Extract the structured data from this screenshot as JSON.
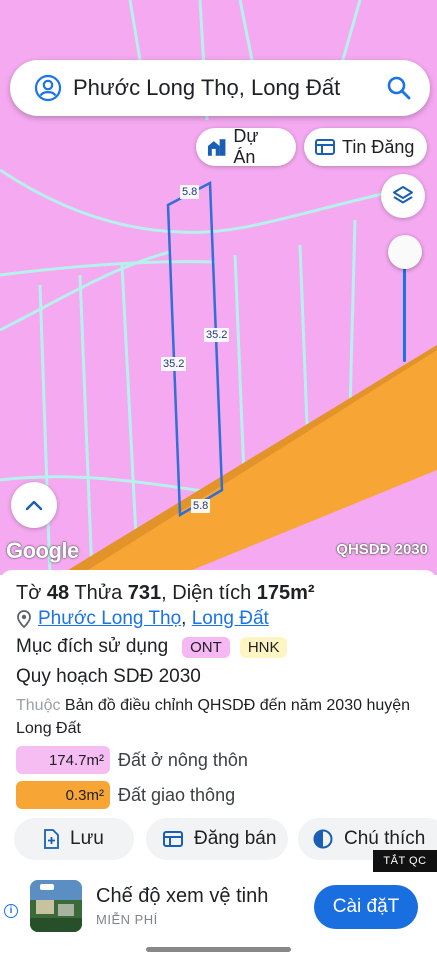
{
  "search": {
    "query": "Phước Long Thọ, Long Đất"
  },
  "map_buttons": {
    "du_an": "Dự Án",
    "tin_dang": "Tin Đăng"
  },
  "map": {
    "watermark": "Google",
    "layer_badge": "QHSDĐ 2030",
    "plot_edges": {
      "top": "5.8",
      "left": "35.2",
      "right": "35.2",
      "bottom": "5.8"
    },
    "colors": {
      "residential": "#f4a9f0",
      "road": "#f7a535",
      "parcel_line": "#b7f1ec",
      "plot_border": "#2f6fd6"
    }
  },
  "parcel": {
    "to_label": "Tờ",
    "to": "48",
    "thua_label": "Thửa",
    "thua": "731",
    "area_label": "Diện tích",
    "area": "175m²",
    "location_1": "Phước Long Thọ",
    "location_sep": ",",
    "location_2": "Long Đất",
    "purpose_label": "Mục đích sử dụng",
    "purpose_tags": [
      "ONT",
      "HNK"
    ],
    "plan_title": "Quy hoạch SDĐ 2030",
    "source_prefix": "Thuộc",
    "source_text": "Bản đồ điều chỉnh QHSDĐ đến năm 2030 huyện Long Đất",
    "legend": [
      {
        "value": "174.7m²",
        "label": "Đất ở nông thôn",
        "color": "#f6bdf3"
      },
      {
        "value": "0.3m²",
        "label": "Đất giao thông",
        "color": "#f7a535"
      }
    ]
  },
  "actions": {
    "save": "Lưu",
    "sell": "Đăng bán",
    "legend": "Chú thích"
  },
  "ad": {
    "close_label": "TẮT QC",
    "title": "Chế độ xem vệ tinh",
    "subtitle": "MIỄN PHÍ",
    "cta": "Cài đặT"
  }
}
